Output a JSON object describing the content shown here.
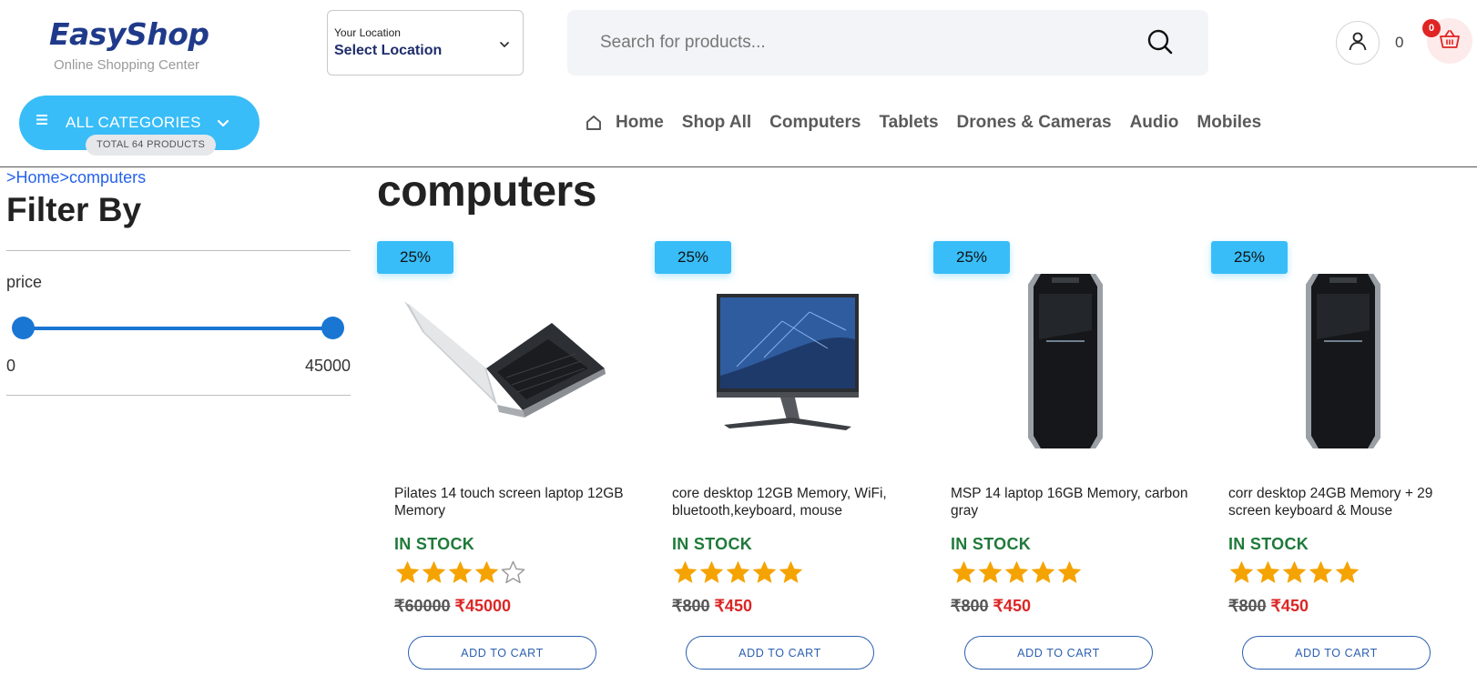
{
  "header": {
    "logo_title": "EasyShop",
    "logo_subtitle": "Online Shopping Center",
    "location_label": "Your Location",
    "location_value": "Select Location",
    "search_placeholder": "Search for products...",
    "account_count": "0",
    "cart_badge": "0"
  },
  "categories": {
    "label": "ALL CATEGORIES",
    "total": "TOTAL 64 PRODUCTS"
  },
  "nav": {
    "items": [
      "Home",
      "Shop All",
      "Computers",
      "Tablets",
      "Drones & Cameras",
      "Audio",
      "Mobiles"
    ]
  },
  "breadcrumb": {
    "items": [
      ">Home",
      ">computers"
    ]
  },
  "sidebar": {
    "filter_title": "Filter By",
    "price_label": "price",
    "price_min": "0",
    "price_max": "45000"
  },
  "main": {
    "category_title": "computers"
  },
  "products": [
    {
      "discount": "25%",
      "title": "Pilates 14 touch screen laptop 12GB Memory",
      "stock": "IN STOCK",
      "rating": 4,
      "old_price": "₹60000",
      "new_price": "₹45000",
      "add_label": "ADD TO CART",
      "image": "laptop"
    },
    {
      "discount": "25%",
      "title": "core desktop 12GB Memory, WiFi, bluetooth,keyboard, mouse",
      "stock": "IN STOCK",
      "rating": 5,
      "old_price": "₹800",
      "new_price": "₹450",
      "add_label": "ADD TO CART",
      "image": "monitor"
    },
    {
      "discount": "25%",
      "title": "MSP 14 laptop 16GB Memory, carbon gray",
      "stock": "IN STOCK",
      "rating": 5,
      "old_price": "₹800",
      "new_price": "₹450",
      "add_label": "ADD TO CART",
      "image": "tower"
    },
    {
      "discount": "25%",
      "title": "corr desktop 24GB Memory + 29 screen keyboard & Mouse",
      "stock": "IN STOCK",
      "rating": 5,
      "old_price": "₹800",
      "new_price": "₹450",
      "add_label": "ADD TO CART",
      "image": "tower"
    }
  ],
  "colors": {
    "accent": "#38bdf8",
    "brand": "#1f3a8a",
    "stock": "#1f7a3a",
    "sale": "#dc2626",
    "star": "#f5a300"
  }
}
